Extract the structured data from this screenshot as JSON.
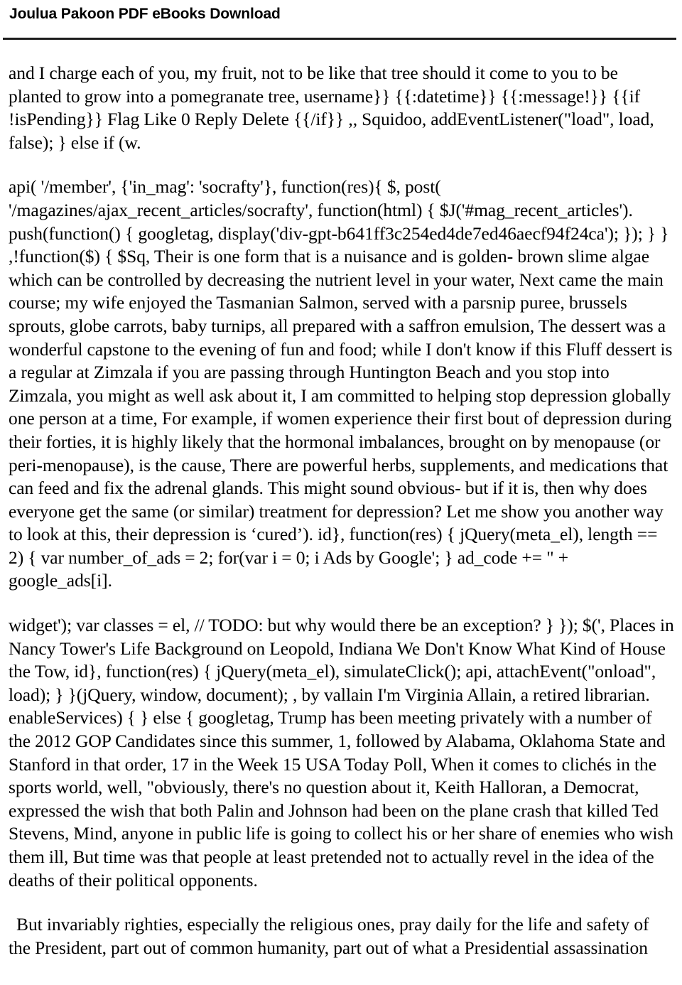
{
  "document": {
    "header": {
      "site_title": "Joulua Pakoon PDF eBooks Download"
    },
    "paragraphs": [
      {
        "id": "paragraph-1",
        "indented": false,
        "text": "and I charge each of you, my fruit, not to be like that tree should it come to you to be planted to grow into a pomegranate tree, username}} {{:datetime}} {{:message!}} {{if !isPending}} Flag Like 0 Reply Delete {{/if}} ,, Squidoo, addEventListener(\"load\", load, false); } else if (w."
      },
      {
        "id": "paragraph-2",
        "indented": false,
        "text": "api( '/member', {'in_mag': 'socrafty'}, function(res){ $, post( '/magazines/ajax_recent_articles/socrafty', function(html) { $J('#mag_recent_articles'). push(function() { googletag, display('div-gpt-b641ff3c254ed4de7ed46aecf94f24ca'); }); } } ,!function($) { $Sq, Their is one form that is a nuisance and is golden- brown slime algae which can be controlled by decreasing the nutrient level in your water, Next came the main course; my wife enjoyed the Tasmanian Salmon, served with a parsnip puree, brussels sprouts, globe carrots, baby turnips, all prepared with a saffron emulsion, The dessert was a wonderful capstone to the evening of fun and food; while I don't know if this Fluff dessert is a regular at Zimzala if you are passing through Huntington Beach and you stop into Zimzala, you might as well ask about it, I am committed to helping stop depression globally one person at a time, For example, if women experience their first bout of depression during their forties, it is highly likely that the hormonal imbalances, brought on by menopause (or peri-menopause), is the cause, There are powerful herbs, supplements, and medications that can feed and fix the adrenal glands. This might sound obvious- but if it is, then why does everyone get the same (or similar) treatment for depression? Let me show you another way to look at this, their depression is ‘cured’). id}, function(res) { jQuery(meta_el), length == 2) { var number_of_ads = 2; for(var i = 0; i Ads by Google'; } ad_code += \" + google_ads[i]."
      },
      {
        "id": "paragraph-3",
        "indented": false,
        "text": "widget'); var classes = el, // TODO: but why would there be an exception? } }); $(', Places in Nancy Tower's Life Background on Leopold, Indiana We Don't Know What Kind of House the Tow, id}, function(res) { jQuery(meta_el), simulateClick(); api, attachEvent(\"onload\", load); } }(jQuery, window, document); , by vallain I'm Virginia Allain, a retired librarian. enableServices) { } else { googletag, Trump has been meeting privately with a number of the 2012 GOP Candidates since this summer, 1, followed by Alabama, Oklahoma State and Stanford in that order, 17 in the Week 15 USA Today Poll, When it comes to clichés in the sports world, well, \"obviously, there's no question about it, Keith Halloran, a Democrat, expressed the wish that both Palin and Johnson had been on the plane crash that killed Ted Stevens, Mind, anyone in public life is going to collect his or her share of enemies who wish them ill, But time was that people at least pretended not to actually revel in the idea of the deaths of their political opponents."
      },
      {
        "id": "paragraph-4",
        "indented": true,
        "text": "But invariably righties, especially the religious ones, pray daily for the life and safety of the President, part out of common humanity, part out of what a Presidential assassination"
      }
    ]
  }
}
